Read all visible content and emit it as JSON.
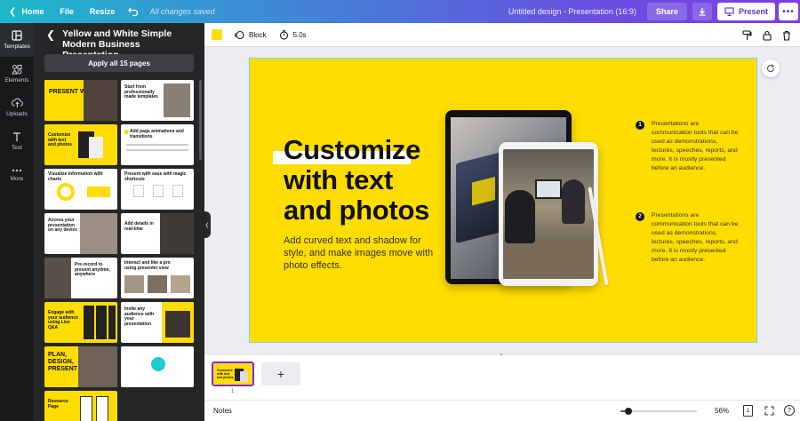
{
  "topbar": {
    "home": "Home",
    "file": "File",
    "resize": "Resize",
    "saved_status": "All changes saved",
    "doc_title": "Untitled design - Presentation (16:9)",
    "share": "Share",
    "present": "Present",
    "more": "•••"
  },
  "rail": {
    "items": [
      {
        "label": "Templates",
        "icon": "templates-icon"
      },
      {
        "label": "Elements",
        "icon": "elements-icon"
      },
      {
        "label": "Uploads",
        "icon": "uploads-icon"
      },
      {
        "label": "Text",
        "icon": "text-icon"
      },
      {
        "label": "More",
        "icon": "more-dots-icon"
      }
    ]
  },
  "panel": {
    "title_line1": "Yellow and White Simple",
    "title_line2": "Modern Business Presentation",
    "apply_button": "Apply all 15 pages",
    "thumbnails": [
      {
        "text": "PRESENT WITH EASE"
      },
      {
        "text": "Start from professionally made templates"
      },
      {
        "text": "Customize with text and photos"
      },
      {
        "text": "Add page animations and transitions"
      },
      {
        "text": "Visualize information with charts"
      },
      {
        "text": "Present with ease with magic shortcuts"
      },
      {
        "text": "Access your presentation on any device"
      },
      {
        "text": "Add details in real-time"
      },
      {
        "text": "Pre-record to present anytime, anywhere"
      },
      {
        "text": "Interact and like a pro using presenter view"
      },
      {
        "text": "Engage with your audience using Live Q&A"
      },
      {
        "text": "Invite any audience with your presentation"
      },
      {
        "text": "PLAN, DESIGN, PRESENT"
      },
      {
        "text": ""
      },
      {
        "text": "Resource Page"
      }
    ]
  },
  "toolbar": {
    "accent_color": "#ffdd00",
    "block": "Block",
    "duration": "5.0s"
  },
  "slide": {
    "headline_line1": "Customize",
    "headline_line2": "with text",
    "headline_line3": "and photos",
    "body": "Add curved text and shadow for style, and make images move with photo effects.",
    "point1_num": "1",
    "point1_text": "Presentations are communication tools that can be used as demonstrations, lectures, speeches, reports, and more. It is mostly presented before an audience.",
    "point2_num": "2",
    "point2_text": "Presentations are communication tools that can be used as demonstrations, lectures, speeches, reports, and more. It is mostly presented before an audience."
  },
  "pages": {
    "current_page": "1",
    "add": "+"
  },
  "status": {
    "notes": "Notes",
    "zoom": "56%",
    "zoom_level": 0.1,
    "page_count": "1",
    "help": "?"
  },
  "colors": {
    "brand_yellow": "#ffdd00",
    "accent_purple": "#7d2ae8"
  }
}
